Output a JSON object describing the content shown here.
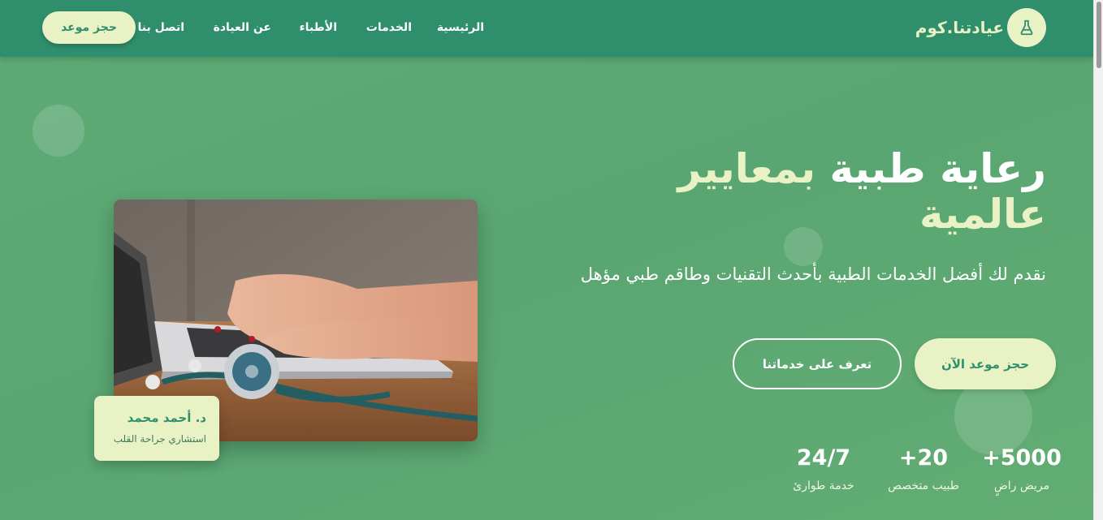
{
  "header": {
    "logo_text": "عيادتنا.كوم",
    "logo_icon": "flask-icon",
    "nav": [
      "الرئيسية",
      "الخدمات",
      "الأطباء",
      "عن العيادة",
      "اتصل بنا"
    ],
    "book_button": "حجز موعد"
  },
  "hero": {
    "title_part1": "رعاية طبية",
    "title_accent": "بمعايير عالمية",
    "subtitle": "نقدم لك أفضل الخدمات الطبية بأحدث التقنيات وطاقم طبي مؤهل",
    "primary_button": "حجز موعد الآن",
    "secondary_button": "تعرف على خدماتنا"
  },
  "stats": [
    {
      "value": "5000+",
      "label": "مريض راضٍ"
    },
    {
      "value": "20+",
      "label": "طبيب متخصص"
    },
    {
      "value": "24/7",
      "label": "خدمة طوارئ"
    }
  ],
  "doctor": {
    "name": "د. أحمد محمد",
    "role": "استشاري جراحة القلب"
  },
  "colors": {
    "header_bg": "#2f8f6d",
    "hero_bg": "#5aa773",
    "accent": "#e8f2c4"
  }
}
